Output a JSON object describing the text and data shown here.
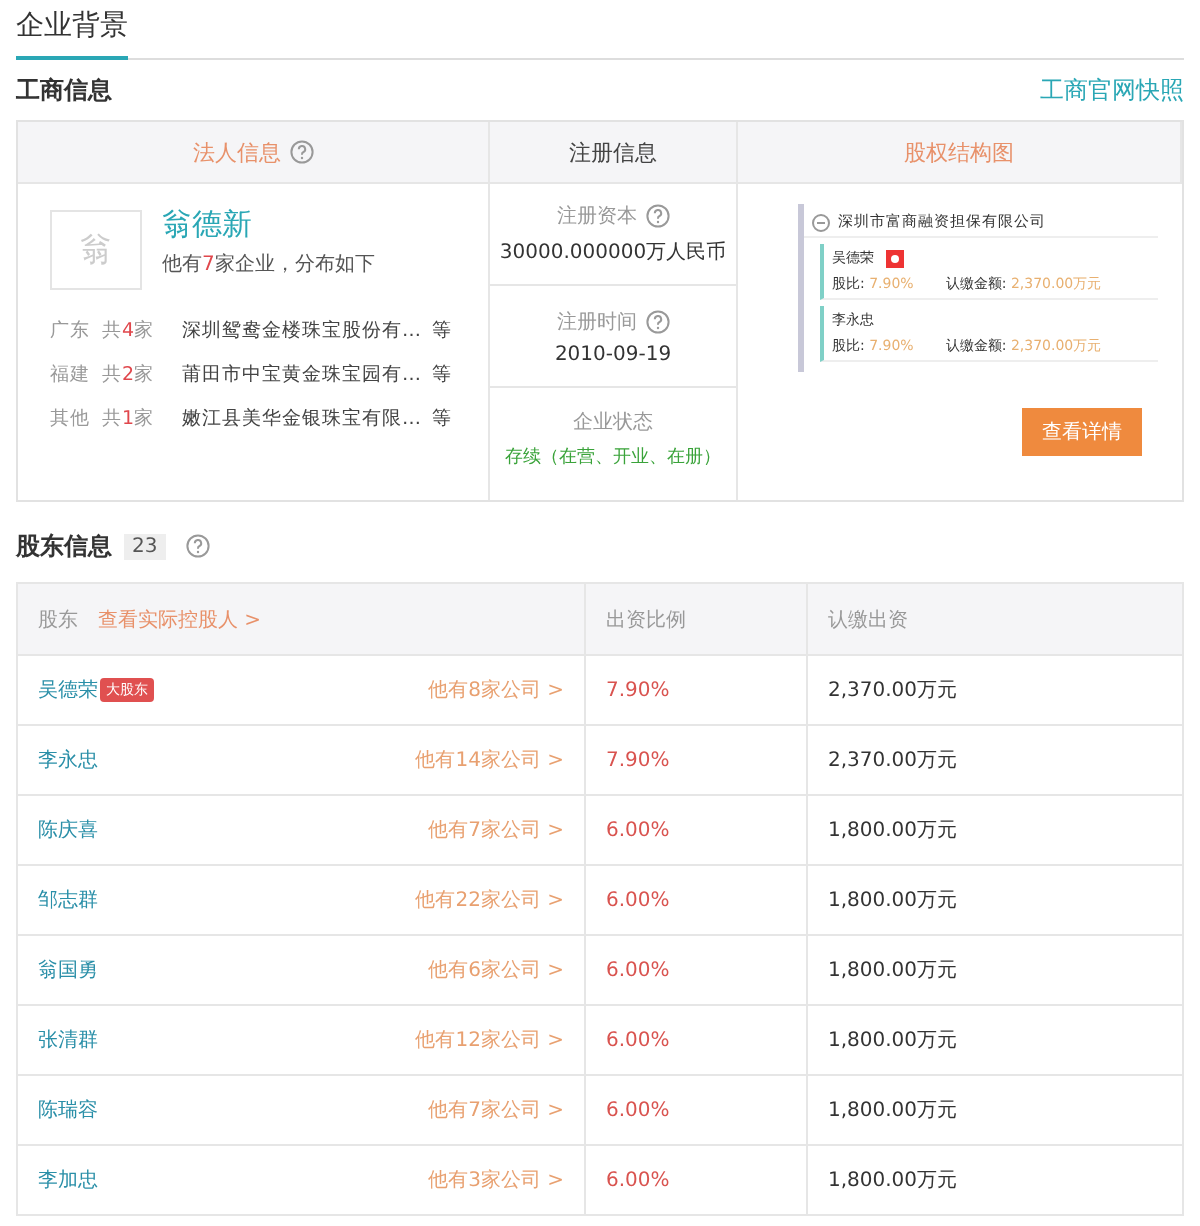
{
  "section_tab": {
    "label": "企业背景",
    "selected": true
  },
  "business_info": {
    "title": "工商信息",
    "link": "工商官网快照",
    "columns": [
      {
        "label": "法人信息",
        "kind": "accent",
        "help": true
      },
      {
        "label": "注册信息",
        "kind": "plain",
        "help": false
      },
      {
        "label": "股权结构图",
        "kind": "accent",
        "help": false
      }
    ],
    "legal_person": {
      "avatar": "翁",
      "name": "翁德新",
      "summary_before": "他有",
      "summary_count": "7",
      "summary_after": "家企业，分布如下",
      "regions": [
        {
          "region": "广东",
          "count_before": "共",
          "count": "4",
          "count_after": "家",
          "company": "深圳鸳鸯金楼珠宝股份有…",
          "suffix": "等"
        },
        {
          "region": "福建",
          "count_before": "共",
          "count": "2",
          "count_after": "家",
          "company": "莆田市中宝黄金珠宝园有…",
          "suffix": "等"
        },
        {
          "region": "其他",
          "count_before": "共",
          "count": "1",
          "count_after": "家",
          "company": "嫩江县美华金银珠宝有限…",
          "suffix": "等"
        }
      ]
    },
    "registration": [
      {
        "label": "注册资本",
        "help": true,
        "value": "30000.000000万人民币",
        "kind": "plain"
      },
      {
        "label": "注册时间",
        "help": true,
        "value": "2010-09-19",
        "kind": "plain"
      },
      {
        "label": "企业状态",
        "help": false,
        "value": "存续（在营、开业、在册）",
        "kind": "status"
      }
    ],
    "equity_chart": {
      "company": "深圳市富商融资担保有限公司",
      "shareholders": [
        {
          "name": "吴德荣",
          "flag": true,
          "ratio_label": "股比:",
          "ratio": "7.90%",
          "amount_label": "认缴金额:",
          "amount": "2,370.00万元"
        },
        {
          "name": "李永忠",
          "flag": false,
          "ratio_label": "股比:",
          "ratio": "7.90%",
          "amount_label": "认缴金额:",
          "amount": "2,370.00万元"
        }
      ],
      "button": "查看详情"
    }
  },
  "shareholders": {
    "title": "股东信息",
    "count": "23",
    "columns": [
      "股东",
      "出资比例",
      "认缴出资"
    ],
    "controller_link": "查看实际控股人 >",
    "rows": [
      {
        "name": "吴德荣",
        "badge": "大股东",
        "companies": "他有8家公司 >",
        "ratio": "7.90%",
        "amount": "2,370.00万元"
      },
      {
        "name": "李永忠",
        "companies": "他有14家公司 >",
        "ratio": "7.90%",
        "amount": "2,370.00万元"
      },
      {
        "name": "陈庆喜",
        "companies": "他有7家公司 >",
        "ratio": "6.00%",
        "amount": "1,800.00万元"
      },
      {
        "name": "邹志群",
        "companies": "他有22家公司 >",
        "ratio": "6.00%",
        "amount": "1,800.00万元"
      },
      {
        "name": "翁国勇",
        "companies": "他有6家公司 >",
        "ratio": "6.00%",
        "amount": "1,800.00万元"
      },
      {
        "name": "张清群",
        "companies": "他有12家公司 >",
        "ratio": "6.00%",
        "amount": "1,800.00万元"
      },
      {
        "name": "陈瑞容",
        "companies": "他有7家公司 >",
        "ratio": "6.00%",
        "amount": "1,800.00万元"
      },
      {
        "name": "李加忠",
        "companies": "他有3家公司 >",
        "ratio": "6.00%",
        "amount": "1,800.00万元"
      }
    ]
  }
}
